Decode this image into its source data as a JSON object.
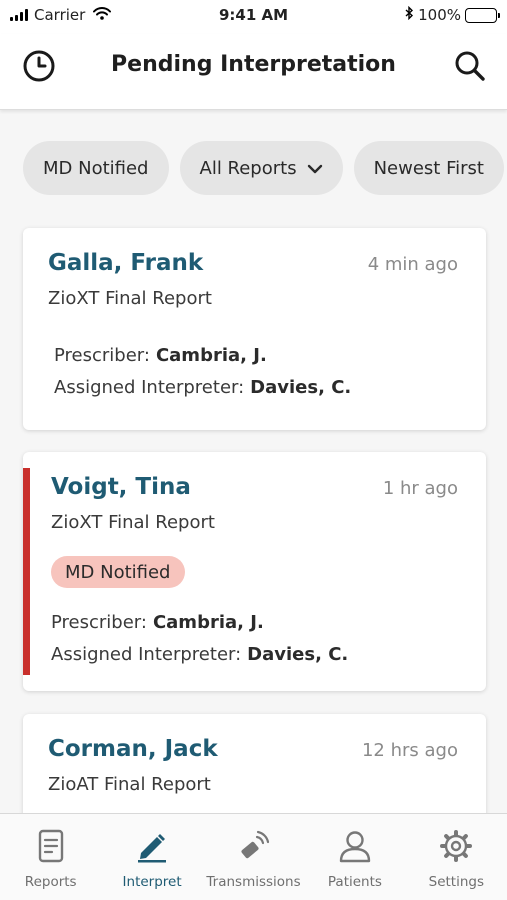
{
  "status_bar": {
    "carrier": "Carrier",
    "time": "9:41 AM",
    "battery": "100%"
  },
  "nav": {
    "title": "Pending Interpretation",
    "left_icon": "clock-icon",
    "right_icon": "search-icon"
  },
  "filters": [
    {
      "label": "MD Notified"
    },
    {
      "label": "All Reports",
      "has_dropdown": true
    },
    {
      "label": "Newest First"
    }
  ],
  "cards": [
    {
      "name": "Galla, Frank",
      "time": "4 min ago",
      "report_type": "ZioXT Final Report",
      "prescriber_label": "Prescriber:",
      "prescriber": "Cambria, J.",
      "interpreter_label": "Assigned Interpreter:",
      "interpreter": "Davies, C."
    },
    {
      "name": "Voigt, Tina",
      "time": "1 hr ago",
      "report_type": "ZioXT Final Report",
      "badge": "MD Notified",
      "prescriber_label": "Prescriber:",
      "prescriber": "Cambria, J.",
      "interpreter_label": "Assigned Interpreter:",
      "interpreter": "Davies, C."
    },
    {
      "name": "Corman, Jack",
      "time": "12 hrs ago",
      "report_type": "ZioAT Final Report"
    }
  ],
  "tabs": [
    {
      "label": "Reports",
      "icon": "document-icon"
    },
    {
      "label": "Interpret",
      "icon": "pen-icon",
      "active": true
    },
    {
      "label": "Transmissions",
      "icon": "transmission-icon"
    },
    {
      "label": "Patients",
      "icon": "person-icon"
    },
    {
      "label": "Settings",
      "icon": "gear-icon"
    }
  ],
  "colors": {
    "accent": "#1f5b73",
    "flag": "#c9302c",
    "badge_bg": "#f7c4bd",
    "chip_bg": "#e5e5e5"
  }
}
